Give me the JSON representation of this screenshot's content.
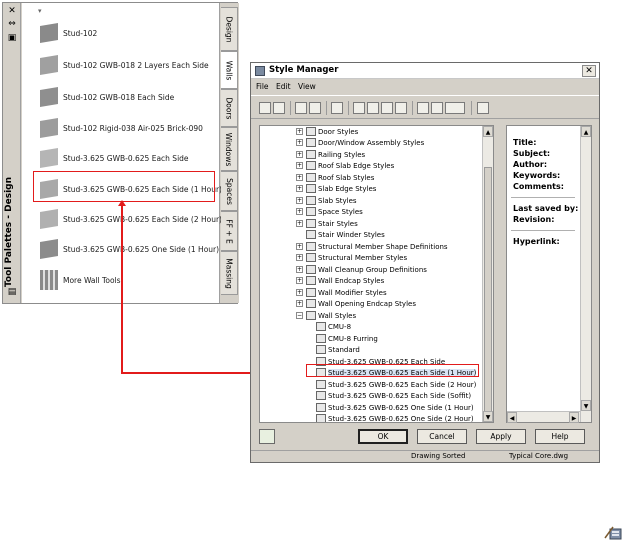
{
  "tool_palette": {
    "title": "Tool Palettes - Design",
    "items": [
      {
        "label": "Stud-102",
        "swatch": "#8a8a8a"
      },
      {
        "label": "Stud-102 GWB-018 2 Layers Each Side",
        "swatch": "#a0a0a0"
      },
      {
        "label": "Stud-102 GWB-018 Each Side",
        "swatch": "#8f8f8f"
      },
      {
        "label": "Stud-102 Rigid-038 Air-025 Brick-090",
        "swatch": "#9c9c9c"
      },
      {
        "label": "Stud-3.625 GWB-0.625 Each Side",
        "swatch": "#b5b5b5"
      },
      {
        "label": "Stud-3.625 GWB-0.625 Each Side (1 Hour)",
        "swatch": "#a8a8a8"
      },
      {
        "label": "Stud-3.625 GWB-0.625 Each Side (2 Hour)",
        "swatch": "#b0b0b0"
      },
      {
        "label": "Stud-3.625 GWB-0.625 One Side (1 Hour)",
        "swatch": "#8c8c8c"
      },
      {
        "label": "More Wall Tools",
        "swatch": "#c6c6c6"
      }
    ],
    "tabs": [
      "Design",
      "Walls",
      "Doors",
      "Windows",
      "Spaces",
      "FF + E",
      "Massing"
    ],
    "active_tab": "Walls"
  },
  "style_manager": {
    "title": "Style Manager",
    "menu": [
      "File",
      "Edit",
      "View"
    ],
    "tree": [
      {
        "label": "Door Styles",
        "level": 1
      },
      {
        "label": "Door/Window Assembly Styles",
        "level": 1
      },
      {
        "label": "Railing Styles",
        "level": 1
      },
      {
        "label": "Roof Slab Edge Styles",
        "level": 1
      },
      {
        "label": "Roof Slab Styles",
        "level": 1
      },
      {
        "label": "Slab Edge Styles",
        "level": 1
      },
      {
        "label": "Slab Styles",
        "level": 1
      },
      {
        "label": "Space Styles",
        "level": 1
      },
      {
        "label": "Stair Styles",
        "level": 1
      },
      {
        "label": "Stair Winder Styles",
        "level": 1
      },
      {
        "label": "Structural Member Shape Definitions",
        "level": 1
      },
      {
        "label": "Structural Member Styles",
        "level": 1
      },
      {
        "label": "Wall Cleanup Group Definitions",
        "level": 1
      },
      {
        "label": "Wall Endcap Styles",
        "level": 1
      },
      {
        "label": "Wall Modifier Styles",
        "level": 1
      },
      {
        "label": "Wall Opening Endcap Styles",
        "level": 1
      },
      {
        "label": "Wall Styles",
        "level": 1,
        "expanded": true
      },
      {
        "label": "CMU-8",
        "level": 2
      },
      {
        "label": "CMU-8 Furring",
        "level": 2
      },
      {
        "label": "Standard",
        "level": 2
      },
      {
        "label": "Stud-3.625 GWB-0.625 Each Side",
        "level": 2
      },
      {
        "label": "Stud-3.625 GWB-0.625 Each Side (1 Hour)",
        "level": 2,
        "selected": true
      },
      {
        "label": "Stud-3.625 GWB-0.625 Each Side (2 Hour)",
        "level": 2
      },
      {
        "label": "Stud-3.625 GWB-0.625 Each Side (Soffit)",
        "level": 2
      },
      {
        "label": "Stud-3.625 GWB-0.625 One Side (1 Hour)",
        "level": 2
      },
      {
        "label": "Stud-3.625 GWB-0.625 One Side (2 Hour)",
        "level": 2
      }
    ],
    "properties": {
      "title": "Title:",
      "subject": "Subject:",
      "author": "Author:",
      "keywords": "Keywords:",
      "comments": "Comments:",
      "last_saved_by": "Last saved by:",
      "revision": "Revision:",
      "hyperlink": "Hyperlink:"
    },
    "buttons": {
      "ok": "OK",
      "cancel": "Cancel",
      "apply": "Apply",
      "help": "Help"
    },
    "status": {
      "sort": "Drawing Sorted",
      "file": "Typical Core.dwg"
    },
    "colors": {
      "callout": "#e21b1b",
      "selection": "#d9e4f4"
    }
  }
}
